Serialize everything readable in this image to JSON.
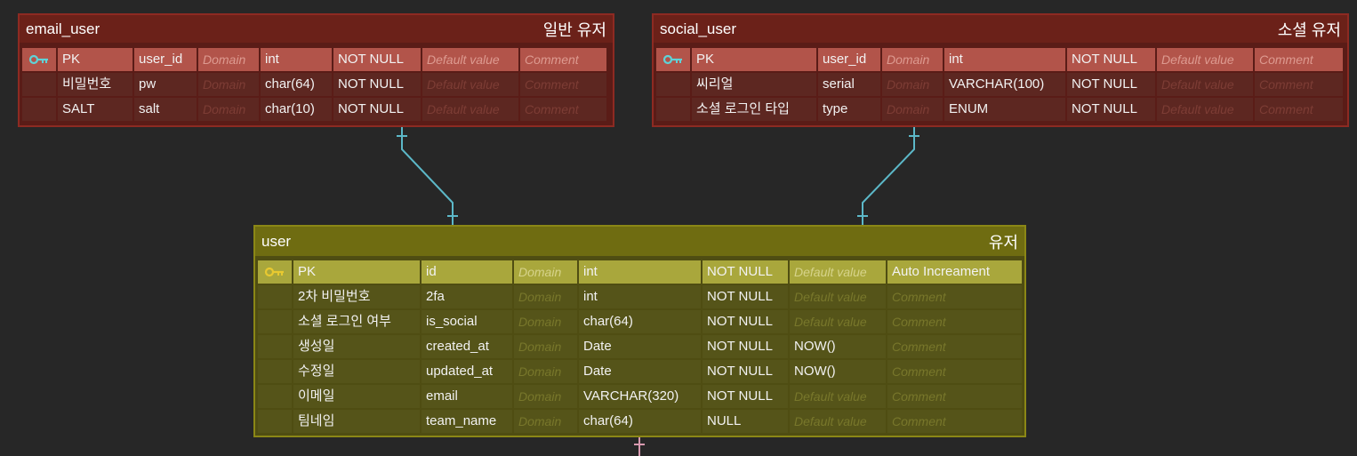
{
  "colors": {
    "background": "#272727",
    "red_table_header": "#6b2119",
    "red_pk_row": "#b2544a",
    "olive_table_header": "#6f6c11",
    "olive_pk_row": "#a9a73c",
    "relation_line": "#5cb8c8",
    "relation_line_pink": "#d99ab0",
    "key_icon_cyan": "#5fd3d8",
    "key_icon_yellow": "#e8c930"
  },
  "tables": {
    "email_user": {
      "physical_name": "email_user",
      "logical_name": "일반 유저",
      "key_icon": "key-icon",
      "rows": [
        {
          "logical": "PK",
          "physical": "user_id",
          "domain": "Domain",
          "type": "int",
          "nullable": "NOT NULL",
          "default": "Default value",
          "comment": "Comment"
        },
        {
          "logical": "비밀번호",
          "physical": "pw",
          "domain": "Domain",
          "type": "char(64)",
          "nullable": "NOT NULL",
          "default": "Default value",
          "comment": "Comment"
        },
        {
          "logical": "SALT",
          "physical": "salt",
          "domain": "Domain",
          "type": "char(10)",
          "nullable": "NOT NULL",
          "default": "Default value",
          "comment": "Comment"
        }
      ]
    },
    "social_user": {
      "physical_name": "social_user",
      "logical_name": "소셜 유저",
      "key_icon": "key-icon",
      "rows": [
        {
          "logical": "PK",
          "physical": "user_id",
          "domain": "Domain",
          "type": "int",
          "nullable": "NOT NULL",
          "default": "Default value",
          "comment": "Comment"
        },
        {
          "logical": "씨리얼",
          "physical": "serial",
          "domain": "Domain",
          "type": "VARCHAR(100)",
          "nullable": "NOT NULL",
          "default": "Default value",
          "comment": "Comment"
        },
        {
          "logical": "소셜 로그인 타입",
          "physical": "type",
          "domain": "Domain",
          "type": "ENUM",
          "nullable": "NOT NULL",
          "default": "Default value",
          "comment": "Comment"
        }
      ]
    },
    "user": {
      "physical_name": "user",
      "logical_name": "유저",
      "key_icon": "key-icon",
      "rows": [
        {
          "logical": "PK",
          "physical": "id",
          "domain": "Domain",
          "type": "int",
          "nullable": "NOT NULL",
          "default": "Default value",
          "comment": "Auto Increament"
        },
        {
          "logical": "2차 비밀번호",
          "physical": "2fa",
          "domain": "Domain",
          "type": "int",
          "nullable": "NOT NULL",
          "default": "Default value",
          "comment": "Comment"
        },
        {
          "logical": "소셜 로그인 여부",
          "physical": "is_social",
          "domain": "Domain",
          "type": "char(64)",
          "nullable": "NOT NULL",
          "default": "Default value",
          "comment": "Comment"
        },
        {
          "logical": "생성일",
          "physical": "created_at",
          "domain": "Domain",
          "type": "Date",
          "nullable": "NOT NULL",
          "default": "NOW()",
          "comment": "Comment"
        },
        {
          "logical": "수정일",
          "physical": "updated_at",
          "domain": "Domain",
          "type": "Date",
          "nullable": "NOT NULL",
          "default": "NOW()",
          "comment": "Comment"
        },
        {
          "logical": "이메일",
          "physical": "email",
          "domain": "Domain",
          "type": "VARCHAR(320)",
          "nullable": "NOT NULL",
          "default": "Default value",
          "comment": "Comment"
        },
        {
          "logical": "팀네임",
          "physical": "team_name",
          "domain": "Domain",
          "type": "char(64)",
          "nullable": "NULL",
          "default": "Default value",
          "comment": "Comment"
        }
      ]
    }
  },
  "relations": [
    {
      "from": "email_user",
      "to": "user",
      "cardinality": "one-to-one"
    },
    {
      "from": "social_user",
      "to": "user",
      "cardinality": "one-to-one"
    }
  ]
}
